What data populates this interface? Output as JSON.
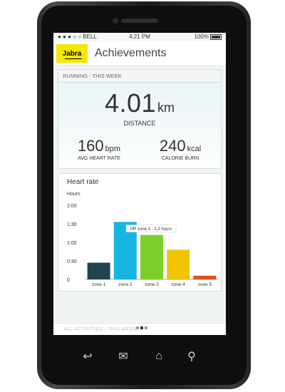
{
  "status": {
    "carrier": "BELL",
    "time": "4:21 PM",
    "battery": "100%"
  },
  "app": {
    "logo": "Jabra",
    "title": "Achievements"
  },
  "summary": {
    "header": "RUNNING - THIS WEEK",
    "distance": {
      "value": "4.01",
      "unit": "km",
      "label": "DISTANCE"
    },
    "heart": {
      "value": "160",
      "unit": "bpm",
      "label": "AVG HEART RATE"
    },
    "calories": {
      "value": "240",
      "unit": "kcal",
      "label": "CALORIE BURN"
    }
  },
  "chart_data": {
    "type": "bar",
    "title": "Heart rate",
    "ylabel": "Hours",
    "categories": [
      "zone 1",
      "zone 2",
      "zone 3",
      "zone 4",
      "zone 5"
    ],
    "values": [
      0.45,
      1.55,
      1.2,
      0.8,
      0.1
    ],
    "colors": [
      "#1f4350",
      "#17b6e0",
      "#7ccf2a",
      "#f2c400",
      "#e2501c"
    ],
    "ylim": [
      0,
      2
    ],
    "yticks": [
      "0",
      "0:30",
      "1:00",
      "1:30",
      "2:00"
    ],
    "annotation": "HR zone 3 - 1.2 hours"
  },
  "footer": {
    "text": "ALL ACTIVITIES - THIS WEEK",
    "active_page": 2,
    "pages": 3
  },
  "navbar": {
    "icons": [
      "back-icon",
      "mail-icon",
      "home-icon",
      "search-icon"
    ]
  }
}
